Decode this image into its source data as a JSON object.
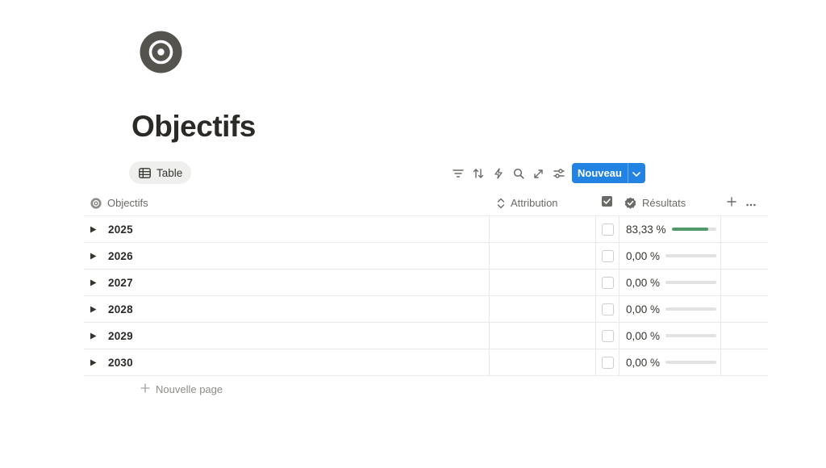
{
  "page": {
    "icon": "target-icon",
    "title": "Objectifs"
  },
  "views": {
    "active_tab": {
      "label": "Table",
      "icon": "table-icon"
    }
  },
  "toolbar": {
    "tools": [
      {
        "name": "filter-icon"
      },
      {
        "name": "sort-icon"
      },
      {
        "name": "automation-icon"
      },
      {
        "name": "search-icon"
      },
      {
        "name": "expand-icon"
      },
      {
        "name": "settings-icon"
      }
    ],
    "new_label": "Nouveau"
  },
  "table": {
    "columns": {
      "name": "Objectifs",
      "attribution": "Attribution",
      "results": "Résultats"
    },
    "rows": [
      {
        "title": "2025",
        "checked": false,
        "result_label": "83,33 %",
        "progress": 0.8333
      },
      {
        "title": "2026",
        "checked": false,
        "result_label": "0,00 %",
        "progress": 0
      },
      {
        "title": "2027",
        "checked": false,
        "result_label": "0,00 %",
        "progress": 0
      },
      {
        "title": "2028",
        "checked": false,
        "result_label": "0,00 %",
        "progress": 0
      },
      {
        "title": "2029",
        "checked": false,
        "result_label": "0,00 %",
        "progress": 0
      },
      {
        "title": "2030",
        "checked": false,
        "result_label": "0,00 %",
        "progress": 0
      }
    ],
    "new_page_label": "Nouvelle page"
  },
  "colors": {
    "accent": "#2383e2",
    "progress_fill": "#4f9a68",
    "progress_track": "#e3e2e0"
  }
}
